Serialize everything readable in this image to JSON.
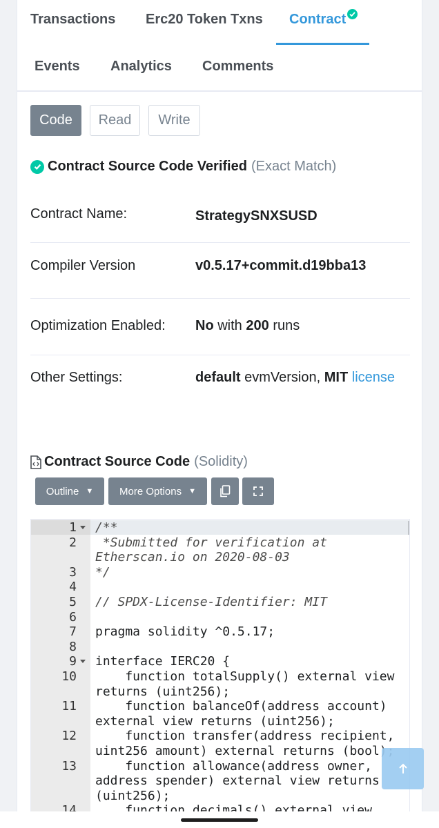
{
  "tabs": {
    "transactions": "Transactions",
    "token_txns": "Erc20 Token Txns",
    "contract": "Contract",
    "events": "Events",
    "analytics": "Analytics",
    "comments": "Comments"
  },
  "view_buttons": {
    "code": "Code",
    "read": "Read",
    "write": "Write"
  },
  "verified": {
    "title": "Contract Source Code Verified",
    "match": "(Exact Match)"
  },
  "info": {
    "name_label": "Contract Name:",
    "name_value": "StrategySNXSUSD",
    "compiler_label": "Compiler Version",
    "compiler_value": "v0.5.17+commit.d19bba13",
    "optimization_label": "Optimization Enabled:",
    "optimization_flag": "No",
    "optimization_with": "with",
    "optimization_runs": "200",
    "optimization_runs_label": "runs",
    "other_label": "Other Settings:",
    "other_evm": "default",
    "other_evm_label": "evmVersion,",
    "other_license": "MIT",
    "other_license_link": "license"
  },
  "source": {
    "title": "Contract Source Code",
    "language": "(Solidity)",
    "outline_label": "Outline",
    "more_options_label": "More Options"
  },
  "code_lines": [
    {
      "n": "1",
      "lines": [
        "/**"
      ]
    },
    {
      "n": "2",
      "lines": [
        " *Submitted for verification at",
        "Etherscan.io on 2020-08-03"
      ]
    },
    {
      "n": "3",
      "lines": [
        "*/"
      ]
    },
    {
      "n": "4",
      "lines": [
        ""
      ]
    },
    {
      "n": "5",
      "lines": [
        "// SPDX-License-Identifier: MIT"
      ]
    },
    {
      "n": "6",
      "lines": [
        ""
      ]
    },
    {
      "n": "7",
      "lines": [
        "pragma solidity ^0.5.17;"
      ]
    },
    {
      "n": "8",
      "lines": [
        ""
      ]
    },
    {
      "n": "9",
      "lines": [
        "interface IERC20 {"
      ]
    },
    {
      "n": "10",
      "lines": [
        "    function totalSupply() external view",
        "returns (uint256);"
      ]
    },
    {
      "n": "11",
      "lines": [
        "    function balanceOf(address account)",
        "external view returns (uint256);"
      ]
    },
    {
      "n": "12",
      "lines": [
        "    function transfer(address recipient,",
        "uint256 amount) external returns (bool);"
      ]
    },
    {
      "n": "13",
      "lines": [
        "    function allowance(address owner,",
        "address spender) external view returns",
        "(uint256);"
      ]
    },
    {
      "n": "14",
      "lines": [
        "    function decimals() external view"
      ]
    }
  ],
  "icons": {
    "check": "check-circle-icon",
    "file_code": "file-code-icon",
    "copy": "copy-icon",
    "fullscreen": "fullscreen-icon",
    "arrow_up": "arrow-up-icon"
  },
  "colors": {
    "accent": "#3498db",
    "success": "#00c9a7",
    "button_gray": "#77838f"
  }
}
